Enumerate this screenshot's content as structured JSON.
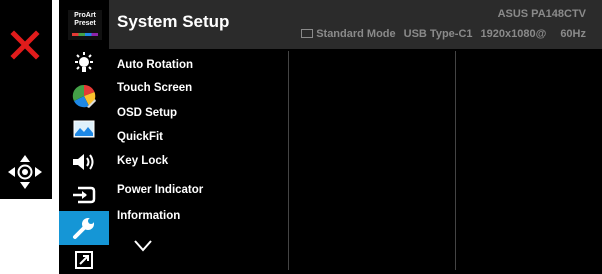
{
  "branding": {
    "proart_line1": "ProArt",
    "proart_line2": "Preset"
  },
  "header": {
    "title": "System Setup",
    "model": "ASUS PA148CTV",
    "color_mode": "Standard Mode",
    "input": "USB Type-C1",
    "resolution": "1920x1080@",
    "refresh": "60Hz"
  },
  "menu_items": [
    "Auto Rotation",
    "Touch Screen",
    "OSD Setup",
    "QuickFit",
    "Key Lock",
    "Power Indicator",
    "Information"
  ],
  "icons": {
    "close": "close-icon",
    "move": "move-arrows-icon",
    "categories": [
      "proart-preset-icon",
      "brightness-icon",
      "color-icon",
      "image-icon",
      "sound-icon",
      "input-select-icon",
      "system-setup-icon",
      "shortcut-icon"
    ]
  },
  "colors": {
    "accent": "#1596d6",
    "close_red": "#e11b1b",
    "header_bg": "#2b2b2b",
    "muted_text": "#8a8a8a"
  }
}
